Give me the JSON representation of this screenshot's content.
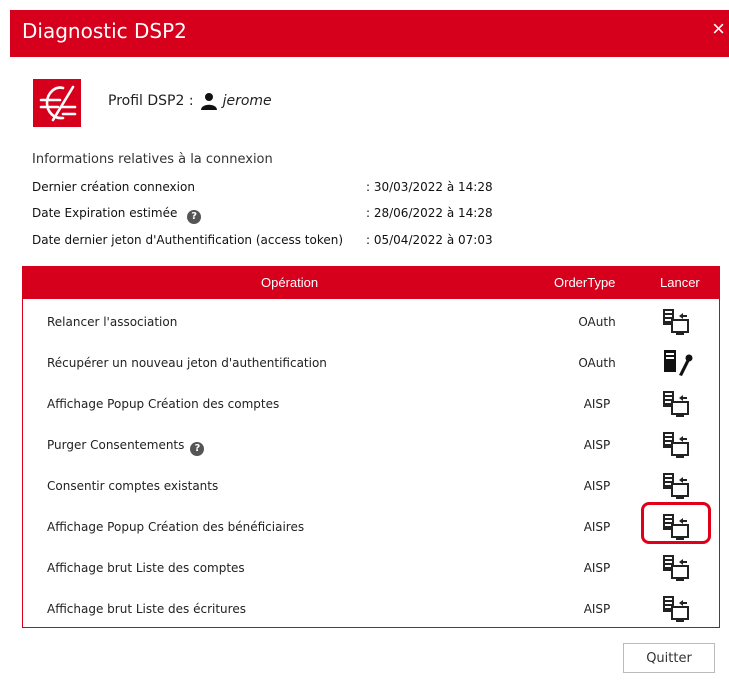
{
  "dialog": {
    "title": "Diagnostic DSP2",
    "close_label": "×",
    "accent_color": "#d6001c"
  },
  "profile": {
    "label": "Profil DSP2 :",
    "user": "jerome"
  },
  "info": {
    "heading": "Informations relatives à la connexion",
    "rows": [
      {
        "label": "Dernier création connexion",
        "value": ": 30/03/2022 à 14:28",
        "help": false
      },
      {
        "label": "Date Expiration estimée",
        "value": ": 28/06/2022 à 14:28",
        "help": true
      },
      {
        "label": "Date dernier jeton d'Authentification (access token)",
        "value": ": 05/04/2022 à 07:03",
        "help": false
      }
    ]
  },
  "table": {
    "headers": [
      "Opération",
      "OrderType",
      "Lancer"
    ],
    "rows": [
      {
        "operation": "Relancer l'association",
        "order_type": "OAuth",
        "icon": "server-screen-icon",
        "help": false
      },
      {
        "operation": "Récupérer un nouveau jeton d'authentification",
        "order_type": "OAuth",
        "icon": "server-key-icon",
        "help": false
      },
      {
        "operation": "Affichage Popup Création des comptes",
        "order_type": "AISP",
        "icon": "server-screen-icon",
        "help": false
      },
      {
        "operation": "Purger Consentements",
        "order_type": "AISP",
        "icon": "server-screen-icon",
        "help": true
      },
      {
        "operation": "Consentir comptes existants",
        "order_type": "AISP",
        "icon": "server-screen-icon",
        "help": false
      },
      {
        "operation": "Affichage Popup Création des bénéficiaires",
        "order_type": "AISP",
        "icon": "server-screen-icon",
        "help": false,
        "highlighted": true
      },
      {
        "operation": "Affichage brut Liste des comptes",
        "order_type": "AISP",
        "icon": "server-screen-icon",
        "help": false
      },
      {
        "operation": "Affichage brut Liste des écritures",
        "order_type": "AISP",
        "icon": "server-screen-icon",
        "help": false
      }
    ]
  },
  "footer": {
    "quit_label": "Quitter"
  }
}
